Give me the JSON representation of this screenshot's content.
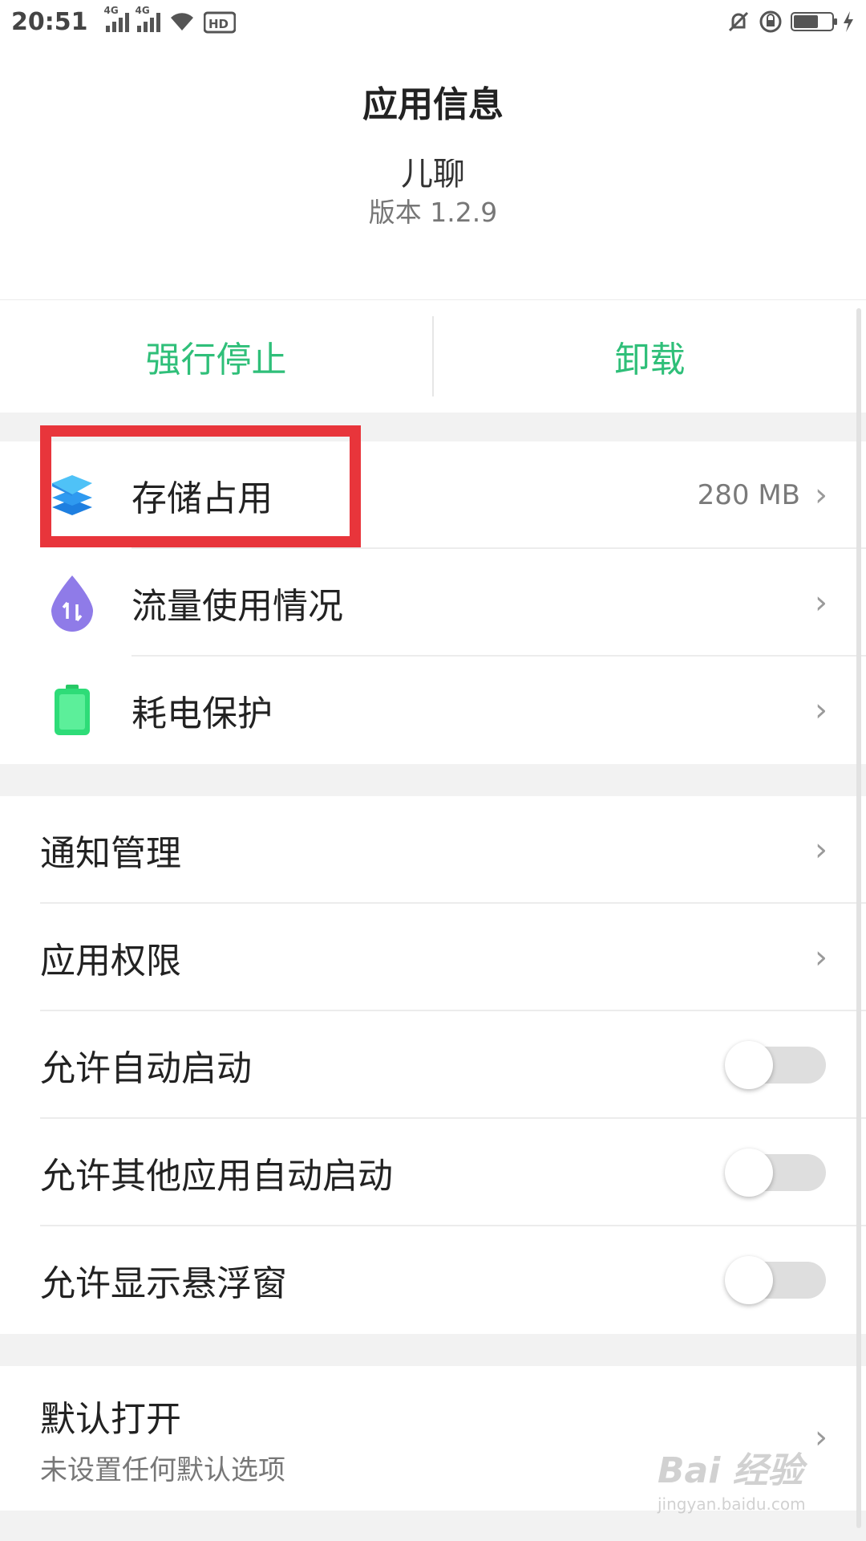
{
  "status_bar": {
    "time": "20:51",
    "network_1": "4G",
    "network_2": "4G",
    "battery_level": 0.65,
    "icons": [
      "signal-icon",
      "signal-icon",
      "wifi-icon",
      "hd-icon",
      "mute-icon",
      "rotation-lock-icon",
      "battery-icon",
      "charging-icon"
    ]
  },
  "header": {
    "title": "应用信息"
  },
  "app": {
    "name": "儿聊",
    "version": "版本 1.2.9"
  },
  "actions": {
    "force_stop": "强行停止",
    "uninstall": "卸载"
  },
  "usage_items": [
    {
      "label": "存储占用",
      "value": "280 MB",
      "icon": "storage-layers-icon"
    },
    {
      "label": "流量使用情况",
      "value": "",
      "icon": "data-usage-icon"
    },
    {
      "label": "耗电保护",
      "value": "",
      "icon": "battery-protect-icon"
    }
  ],
  "settings_items": [
    {
      "label": "通知管理",
      "type": "link"
    },
    {
      "label": "应用权限",
      "type": "link"
    },
    {
      "label": "允许自动启动",
      "type": "toggle",
      "checked": false
    },
    {
      "label": "允许其他应用自动启动",
      "type": "toggle",
      "checked": false
    },
    {
      "label": "允许显示悬浮窗",
      "type": "toggle",
      "checked": false
    }
  ],
  "default_open": {
    "label": "默认打开",
    "sub": "未设置任何默认选项"
  },
  "colors": {
    "accent": "#2fbf79",
    "highlight": "#e8353b"
  },
  "watermark": {
    "text": "Bai 经验",
    "sub": "jingyan.baidu.com"
  }
}
